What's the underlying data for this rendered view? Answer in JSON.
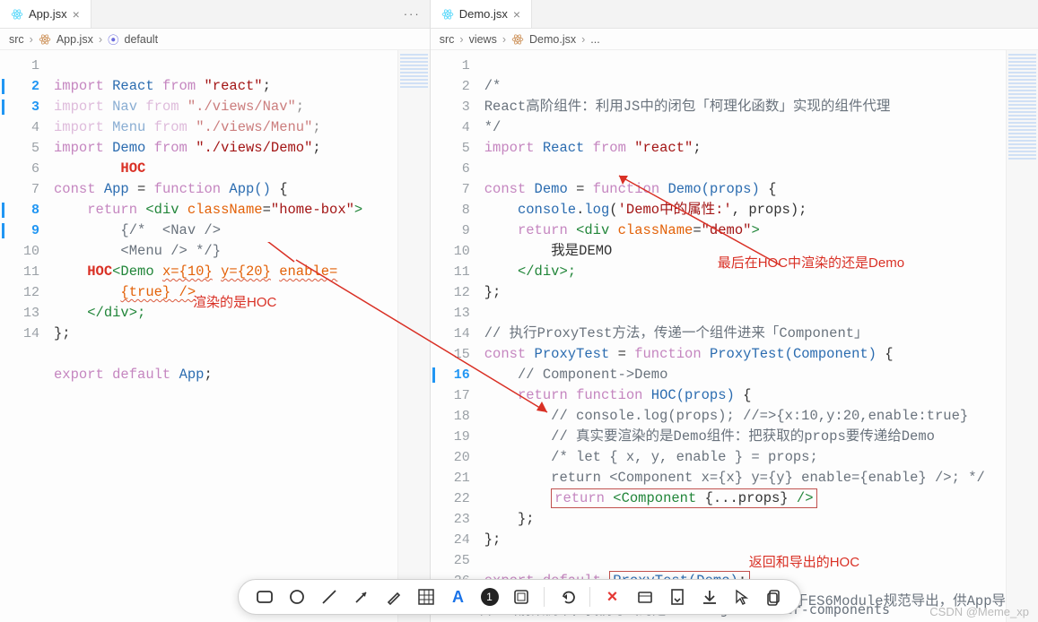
{
  "left": {
    "tab": "App.jsx",
    "breadcrumb": {
      "root": "src",
      "file": "App.jsx",
      "symbol": "default"
    },
    "lines_numbers": [
      "1",
      "2",
      "3",
      "4",
      "5",
      "6",
      "7",
      "8",
      "9",
      "10",
      "",
      "11",
      "12",
      "13",
      "14"
    ],
    "code": {
      "l1": {
        "import": "import",
        "id": "React",
        "from": "from",
        "str": "\"react\""
      },
      "l2": {
        "import": "import",
        "id": "Nav",
        "from": "from",
        "str": "\"./views/Nav\""
      },
      "l3": {
        "import": "import",
        "id": "Menu",
        "from": "from",
        "str": "\"./views/Menu\""
      },
      "l4": {
        "import": "import",
        "id": "Demo",
        "from": "from",
        "str": "\"./views/Demo\""
      },
      "l5": "HOC",
      "l6": {
        "const": "const",
        "name": "App",
        "eq": "=",
        "fn": "function",
        "call": "App()",
        "brace": "{"
      },
      "l7": {
        "ret": "return",
        "open": "<div",
        "attrn": "className",
        "attrv": "\"home-box\"",
        "end": ">"
      },
      "l8": "{/*  <Nav />",
      "l9": "<Menu /> */}",
      "l10": {
        "hoc": "HOC",
        "tag": "<Demo",
        "x": "x={10}",
        "y": "y={20}",
        "en": "enable="
      },
      "l10b": "{true} />",
      "l11": "</div>;",
      "l12": "};",
      "l14": {
        "exp": "export",
        "def": "default",
        "id": "App"
      }
    },
    "annotation_render": "渲染的是HOC"
  },
  "right": {
    "tab": "Demo.jsx",
    "breadcrumb": {
      "root": "src",
      "views": "views",
      "file": "Demo.jsx",
      "symbol": "..."
    },
    "lines_numbers": [
      "1",
      "2",
      "3",
      "4",
      "5",
      "6",
      "7",
      "8",
      "9",
      "10",
      "11",
      "12",
      "13",
      "14",
      "15",
      "16",
      "17",
      "18",
      "19",
      "20",
      "21",
      "22",
      "23",
      "24",
      "25",
      "26"
    ],
    "code": {
      "l1": "/*",
      "l2": "React高阶组件：利用JS中的闭包「柯理化函数」实现的组件代理",
      "l3": "*/",
      "l4": {
        "import": "import",
        "id": "React",
        "from": "from",
        "str": "\"react\""
      },
      "l6": {
        "const": "const",
        "name": "Demo",
        "eq": "=",
        "fn": "function",
        "call": "Demo(props)",
        "brace": "{"
      },
      "l7": "console.log('Demo中的属性:', props);",
      "l8": {
        "ret": "return",
        "open": "<div",
        "attrn": "className",
        "attrv": "\"demo\"",
        "end": ">"
      },
      "l9": "我是DEMO",
      "l10": "</div>;",
      "l11": "};",
      "l13": "// 执行ProxyTest方法，传递一个组件进来「Component」",
      "l14": {
        "const": "const",
        "name": "ProxyTest",
        "eq": "=",
        "fn": "function",
        "call": "ProxyTest(Component)",
        "brace": "{"
      },
      "l15": "// Component->Demo",
      "l16": {
        "ret": "return",
        "fn": "function",
        "call": "HOC(props)",
        "brace": "{"
      },
      "l17": "// console.log(props); //=>{x:10,y:20,enable:true}",
      "l18": "// 真实要渲染的是Demo组件：把获取的props要传递给Demo",
      "l19": "/* let { x, y, enable } = props;",
      "l20": "return <Component x={x} y={y} enable={enable} />; */",
      "l21": "return <Component {...props} />",
      "l22": "};",
      "l23": "};",
      "l25": {
        "exp": "export",
        "def": "default",
        "call": "ProxyTest(Demo)"
      },
      "l26": "// 把函数执行的返回结果「应该是一个组件」，基于ES6Module规范导出，供App导"
    },
    "annotation_last": "最后在HOC中渲染的还是Demo",
    "annotation_return": "返回和导出的HOC"
  },
  "bottom_ghost": "// 当前案例中，我们导出的是HOC：Higher-order-components",
  "toolbar_count": "1",
  "toolbar_letter": "A",
  "watermark": "CSDN @Meme_xp"
}
